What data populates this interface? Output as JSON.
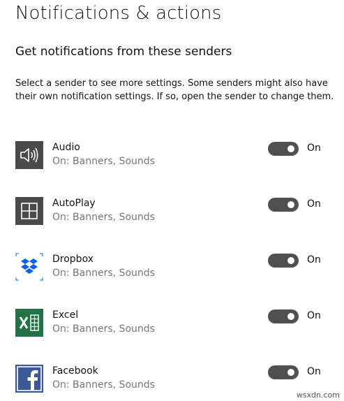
{
  "page": {
    "title": "Notifications & actions",
    "section_title": "Get notifications from these senders",
    "description": "Select a sender to see more settings. Some senders might also have their own notification settings. If so, open the sender to change them."
  },
  "senders": [
    {
      "name": "Audio",
      "status": "On: Banners, Sounds",
      "toggle": "On",
      "icon": "speaker-icon",
      "tile_color": "#4a4a4a"
    },
    {
      "name": "AutoPlay",
      "status": "On: Banners, Sounds",
      "toggle": "On",
      "icon": "autoplay-icon",
      "tile_color": "#4a4a4a"
    },
    {
      "name": "Dropbox",
      "status": "On: Banners, Sounds",
      "toggle": "On",
      "icon": "dropbox-icon",
      "tile_color": "#0061ff"
    },
    {
      "name": "Excel",
      "status": "On: Banners, Sounds",
      "toggle": "On",
      "icon": "excel-icon",
      "tile_color": "#217346"
    },
    {
      "name": "Facebook",
      "status": "On: Banners, Sounds",
      "toggle": "On",
      "icon": "facebook-icon",
      "tile_color": "#3b5998"
    }
  ],
  "watermark": "wsxdn.com"
}
